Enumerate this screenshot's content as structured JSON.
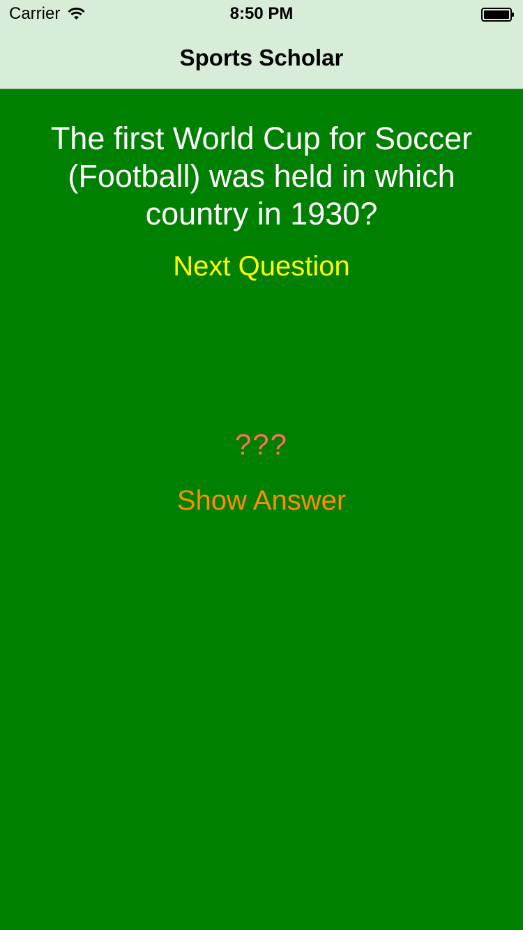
{
  "status_bar": {
    "carrier": "Carrier",
    "time": "8:50 PM",
    "wifi_icon": "wifi-icon",
    "battery_icon": "battery-icon"
  },
  "nav": {
    "title": "Sports Scholar"
  },
  "main": {
    "question": "The first World Cup for Soccer (Football) was held in which country in 1930?",
    "next_button_label": "Next Question",
    "answer_placeholder": "???",
    "show_answer_label": "Show Answer"
  },
  "colors": {
    "background": "#008000",
    "nav_bar": "#d8edd8",
    "question_text": "#ffffff",
    "next_button": "#ffff00",
    "answer_text": "#ff6f61",
    "show_answer_button": "#ff8c00"
  }
}
